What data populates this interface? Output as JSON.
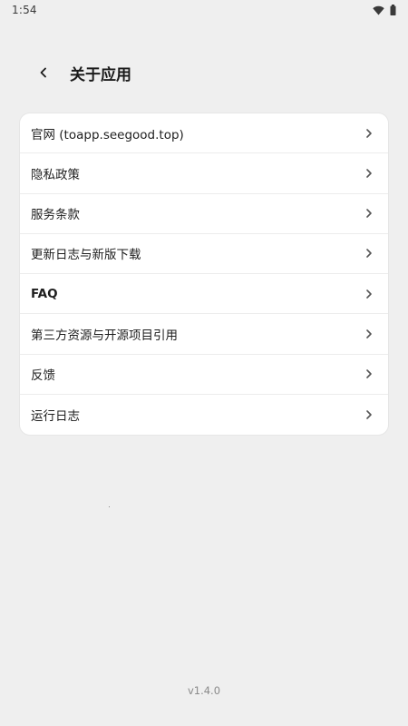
{
  "status_bar": {
    "time": "1:54",
    "icons": [
      "wifi-icon",
      "battery-icon"
    ]
  },
  "header": {
    "back_icon": "chevron-left-icon",
    "title": "关于应用"
  },
  "menu": {
    "items": [
      {
        "label": "官网 (toapp.seegood.top)",
        "icon": "chevron-right-icon"
      },
      {
        "label": "隐私政策",
        "icon": "chevron-right-icon"
      },
      {
        "label": "服务条款",
        "icon": "chevron-right-icon"
      },
      {
        "label": "更新日志与新版下载",
        "icon": "chevron-right-icon"
      },
      {
        "label": "FAQ",
        "icon": "chevron-right-icon"
      },
      {
        "label": "第三方资源与开源项目引用",
        "icon": "chevron-right-icon"
      },
      {
        "label": "反馈",
        "icon": "chevron-right-icon"
      },
      {
        "label": "运行日志",
        "icon": "chevron-right-icon"
      }
    ]
  },
  "footer": {
    "version": "v1.4.0"
  },
  "colors": {
    "background": "#efefef",
    "card": "#ffffff",
    "text": "#1e1e1e",
    "muted": "#8a8a8a"
  }
}
